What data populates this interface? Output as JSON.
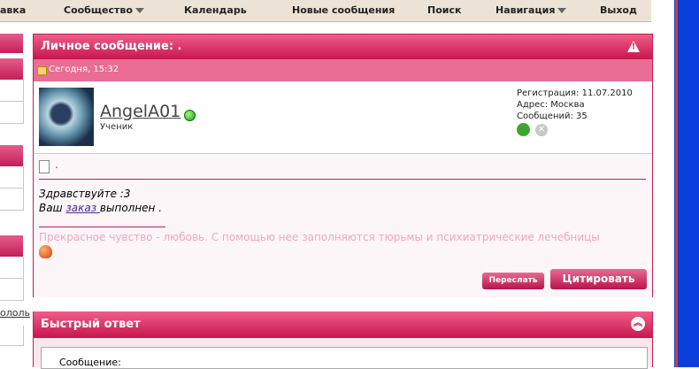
{
  "nav": {
    "items": [
      {
        "label": "авка",
        "caret": false
      },
      {
        "label": "Сообщество",
        "caret": true
      },
      {
        "label": "Календарь",
        "caret": false
      },
      {
        "label": "Новые сообщения",
        "caret": false
      },
      {
        "label": "Поиск",
        "caret": false
      },
      {
        "label": "Навигация",
        "caret": true
      },
      {
        "label": "Выход",
        "caret": false
      }
    ]
  },
  "sidebar": {
    "fragment_text": "ололь"
  },
  "post": {
    "header_title": "Личное сообщение: .",
    "date": "Сегодня, 15:32",
    "user": {
      "name": "AngelA01",
      "role": "Ученик",
      "registration": "Регистрация: 11.07.2010",
      "address": "Адрес: Москва",
      "posts": "Сообщений: 35"
    },
    "title": ".",
    "message_line1": "Здравствуйте :3",
    "message_line2_prefix": "Ваш ",
    "message_line2_link": "заказ ",
    "message_line2_suffix": "выполнен .",
    "signature": "Прекрасное чувство - любовь. С помощью нее заполняются тюрьмы и психиатрические лечебницы",
    "buttons": {
      "forward": "Переслать",
      "quote": "Цитировать"
    }
  },
  "quick_reply": {
    "title": "Быстрый ответ",
    "message_label": "Сообщение:"
  },
  "colors": {
    "accent": "#c7164f",
    "accent_light": "#ea6d93",
    "nav_bg": "#ece3d6",
    "signature": "#f0a6bd"
  }
}
